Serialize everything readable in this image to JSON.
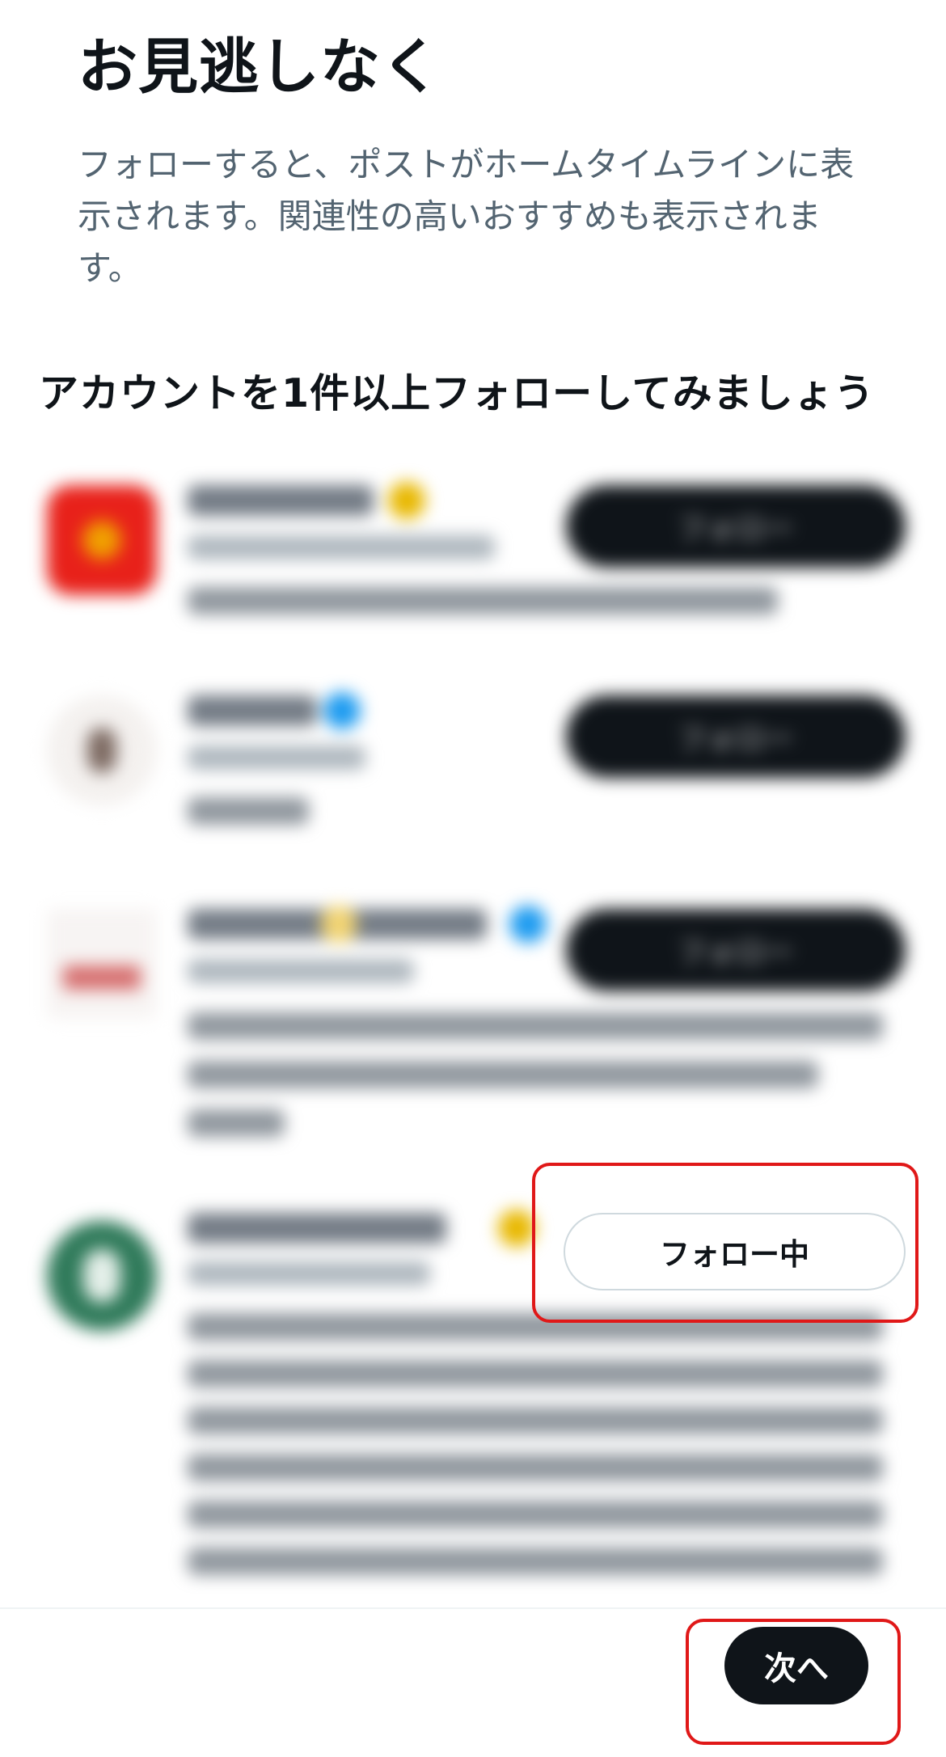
{
  "title": "お見逃しなく",
  "description": "フォローすると、ポストがホームタイムラインに表示されます。関連性の高いおすすめも表示されます。",
  "subtitle": "アカウントを1件以上フォローしてみましょう",
  "accounts": [
    {
      "follow_label": "フォロー",
      "following": false
    },
    {
      "follow_label": "フォロー",
      "following": false
    },
    {
      "follow_label": "フォロー",
      "following": false
    },
    {
      "follow_label": "フォロー中",
      "following": true
    }
  ],
  "footer": {
    "next_label": "次へ"
  },
  "colors": {
    "primary_button": "#0f1419",
    "highlight": "#e01818",
    "secondary_text": "#536471"
  }
}
